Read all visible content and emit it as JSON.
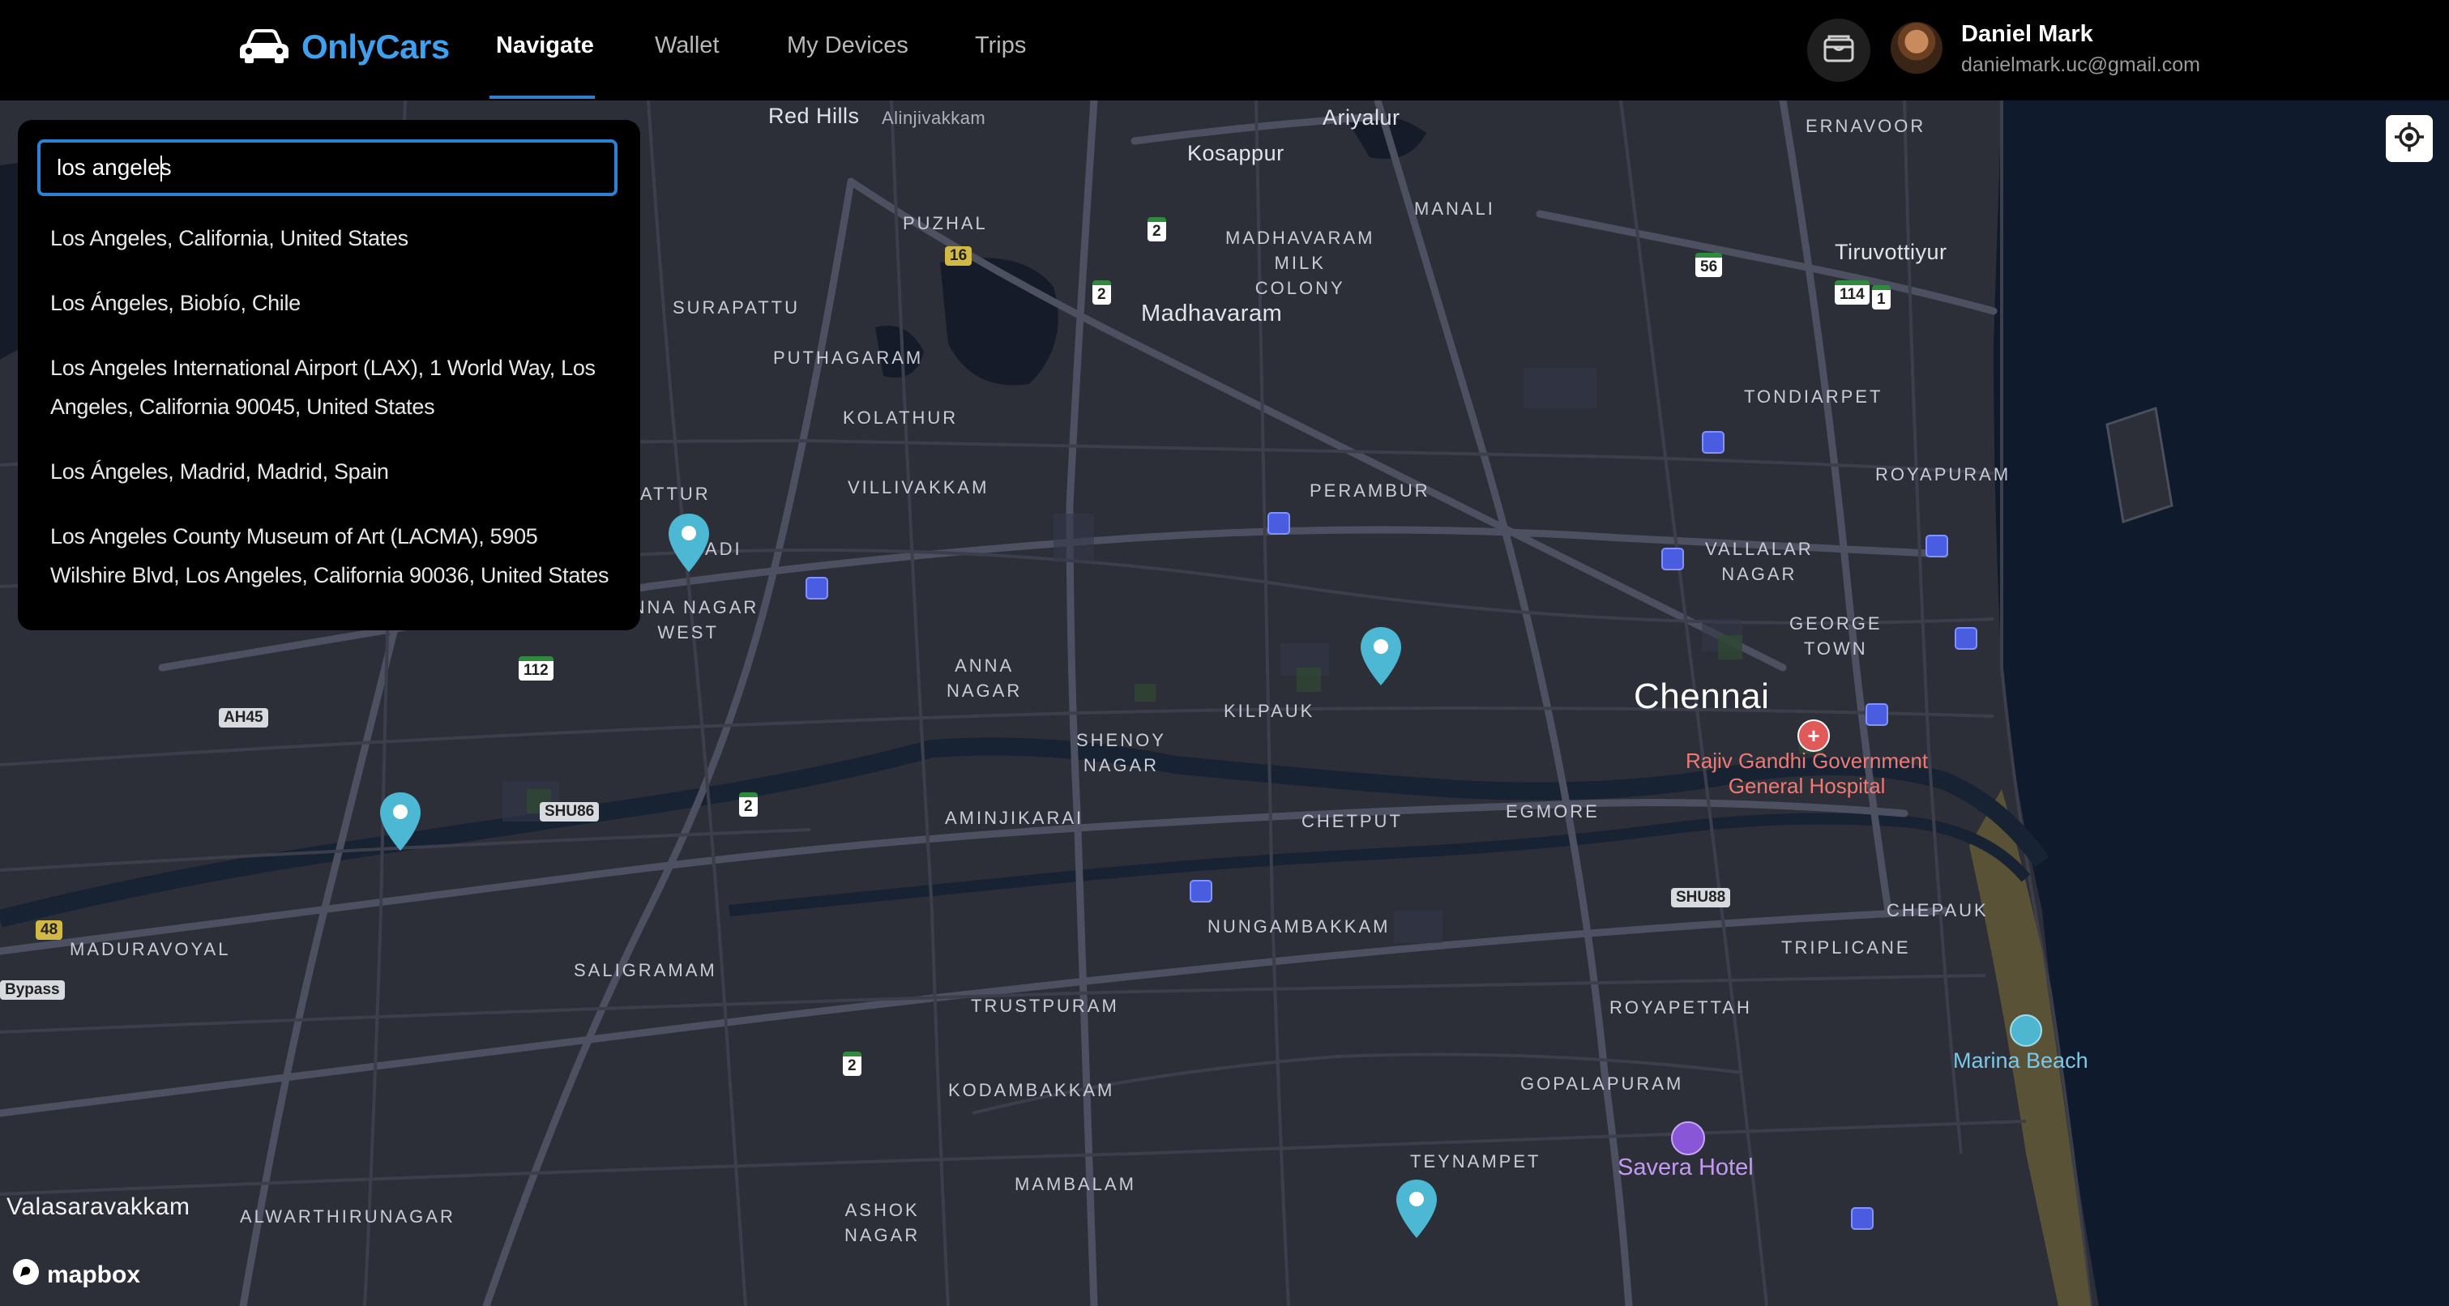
{
  "brand": {
    "name": "OnlyCars",
    "logo_icon": "car-icon"
  },
  "nav": {
    "tabs": [
      {
        "label": "Navigate",
        "active": true
      },
      {
        "label": "Wallet",
        "active": false
      },
      {
        "label": "My Devices",
        "active": false
      },
      {
        "label": "Trips",
        "active": false
      }
    ]
  },
  "user": {
    "name": "Daniel Mark",
    "email": "danielmark.uc@gmail.com",
    "wallet_icon": "wallet-icon"
  },
  "search": {
    "value": "los angeles",
    "suggestions": [
      "Los Angeles, California, United States",
      "Los Ángeles, Biobío, Chile",
      "Los Angeles International Airport (LAX), 1 World Way, Los Angeles, California 90045, United States",
      "Los Ángeles, Madrid, Madrid, Spain",
      "Los Angeles County Museum of Art (LACMA), 5905 Wilshire Blvd, Los Angeles, California 90036, United States"
    ]
  },
  "map": {
    "labels": {
      "red_hills": "Red Hills",
      "alinjivakkam": "Alinjivakkam",
      "ariyalur": "Ariyalur",
      "kosappur": "Kosappur",
      "ernavoor": "ERNAVOOR",
      "puzhal": "PUZHAL",
      "manali": "MANALI",
      "madhavaram_milk_colony": "MADHAVARAM\nMILK\nCOLONY",
      "tiruvottiyur": "Tiruvottiyur",
      "surapattu": "SURAPATTU",
      "madhavaram": "Madhavaram",
      "puthagaram": "PUTHAGARAM",
      "tondiarpet": "TONDIARPET",
      "kolathur": "KOLATHUR",
      "royapuram": "ROYAPURAM",
      "villivakkam": "VILLIVAKKAM",
      "perambur": "PERAMBUR",
      "attur": "ATTUR",
      "adi": "ADI",
      "anna_nagar_west": "ANNA NAGAR\nWEST",
      "vallalar_nagar": "VALLALAR\nNAGAR",
      "george_town": "GEORGE\nTOWN",
      "anna_nagar": "ANNA\nNAGAR",
      "kilpauk": "KILPAUK",
      "chennai": "Chennai",
      "rajiv_gandhi_hospital": "Rajiv Gandhi Government\nGeneral Hospital",
      "shenoy_nagar": "SHENOY\nNAGAR",
      "aminjikarai": "AMINJIKARAI",
      "chetput": "CHETPUT",
      "egmore": "EGMORE",
      "nungambakkam": "NUNGAMBAKKAM",
      "chepauk": "CHEPAUK",
      "maduravoyal": "MADURAVOYAL",
      "triplicane": "TRIPLICANE",
      "saligramam": "SALIGRAMAM",
      "trustpuram": "TRUSTPURAM",
      "royapettah": "ROYAPETTAH",
      "marina_beach": "Marina Beach",
      "kodambakkam": "KODAMBAKKAM",
      "gopalapuram": "GOPALAPURAM",
      "savera_hotel": "Savera Hotel",
      "teynampet": "TEYNAMPET",
      "mambalam": "MAMBALAM",
      "ashok_nagar": "ASHOK\nNAGAR",
      "valasaravakkam": "Valasaravakkam",
      "alwarthirunagar": "ALWARTHIRUNAGAR"
    },
    "shields": {
      "s16": "16",
      "s2a": "2",
      "s2b": "2",
      "s56": "56",
      "s114": "114",
      "s1": "1",
      "s112": "112",
      "ah45": "AH45",
      "shu86": "SHU86",
      "s2c": "2",
      "shu88": "SHU88",
      "s48": "48",
      "bypass": "Bypass",
      "s2d": "2"
    },
    "attribution": "mapbox",
    "locate_icon": "crosshair-icon",
    "marker_count": 5
  },
  "colors": {
    "brand": "#3fa0f0",
    "accent": "#2a82d6",
    "marker": "#4cb8d4",
    "map_bg": "#2c2e38",
    "water": "#0f1a2c"
  }
}
